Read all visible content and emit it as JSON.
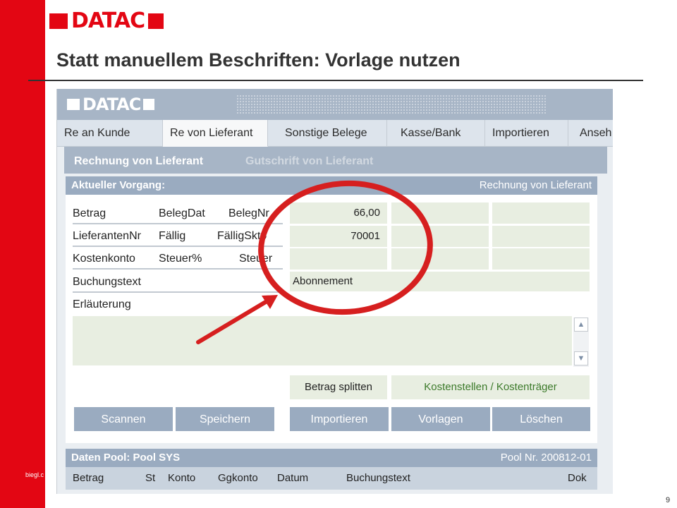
{
  "slide": {
    "logo_text": "DATAC",
    "title": "Statt manuellem Beschriften: Vorlage nutzen",
    "footer_small": "biegl.c",
    "page_number": "9"
  },
  "app": {
    "logo_text": "DATAC",
    "tabs": [
      {
        "label": "Re an Kunde",
        "active": false
      },
      {
        "label": "Re von Lieferant",
        "active": true
      },
      {
        "label": "Sonstige Belege",
        "active": false
      },
      {
        "label": "Kasse/Bank",
        "active": false
      },
      {
        "label": "Importieren",
        "active": false
      },
      {
        "label": "Anseh",
        "active": false
      }
    ],
    "subtabs": [
      {
        "label": "Rechnung von Lieferant",
        "active": true
      },
      {
        "label": "Gutschrift von Lieferant",
        "active": false
      }
    ],
    "vorgang": {
      "header_left": "Aktueller Vorgang:",
      "header_right": "Rechnung von Lieferant",
      "rows": [
        {
          "labels": [
            "Betrag",
            "BelegDat",
            "BelegNr"
          ],
          "value": "66,00"
        },
        {
          "labels": [
            "LieferantenNr",
            "Fällig",
            "FälligSkto"
          ],
          "value": "70001"
        },
        {
          "labels": [
            "Kostenkonto",
            "Steuer%",
            "Steuer"
          ],
          "value": ""
        }
      ],
      "buchungstext_label": "Buchungstext",
      "buchungstext_value": "Abonnement",
      "erlaeuterung_label": "Erläuterung",
      "betrag_splitten": "Betrag splitten",
      "kostenstellen": "Kostenstellen / Kostenträger",
      "buttons": [
        "Scannen",
        "Speichern",
        "Importieren",
        "Vorlagen",
        "Löschen"
      ]
    },
    "pool": {
      "header_left": "Daten Pool: Pool SYS",
      "header_right": "Pool Nr. 200812-01",
      "columns": [
        "Betrag",
        "St",
        "Konto",
        "Ggkonto",
        "Datum",
        "Buchungstext",
        "Dok"
      ]
    }
  },
  "colors": {
    "brand_red": "#e30613",
    "app_header": "#a7b5c6",
    "section_header": "#9aabc0",
    "field_bg": "#e8eee1",
    "annotation_red": "#d61f1f",
    "inactive_subtab": "#d2d9e1",
    "kostenstellen_text": "#3c7a2a"
  },
  "icons": {
    "scroll_up": "triangle-up-icon",
    "scroll_down": "triangle-down-icon"
  }
}
